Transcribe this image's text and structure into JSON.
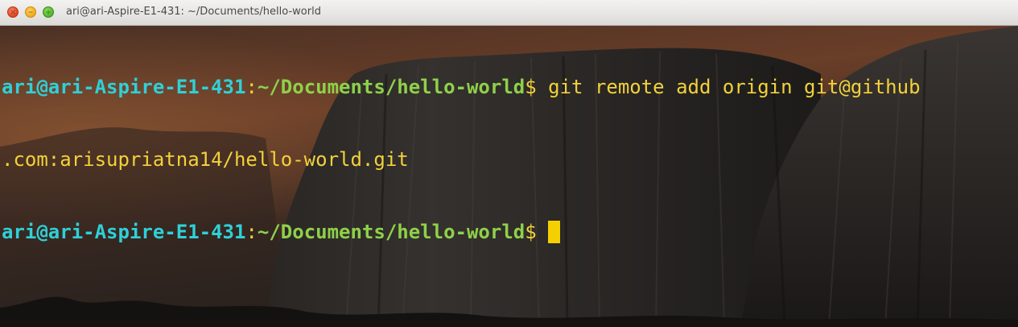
{
  "window": {
    "title": "ari@ari-Aspire-E1-431: ~/Documents/hello-world"
  },
  "terminal": {
    "lines": [
      {
        "user": "ari@ari-Aspire-E1-431",
        "separator": ":",
        "path": "~/Documents/hello-world",
        "prompt": "$ ",
        "command": "git remote add origin git@github"
      },
      {
        "continuation": ".com:arisupriatna14/hello-world.git"
      },
      {
        "user": "ari@ari-Aspire-E1-431",
        "separator": ":",
        "path": "~/Documents/hello-world",
        "prompt": "$ "
      }
    ]
  },
  "colors": {
    "user": "#2fd0d8",
    "path": "#8ed14a",
    "text": "#f3d13a",
    "cursor": "#f4d000"
  }
}
